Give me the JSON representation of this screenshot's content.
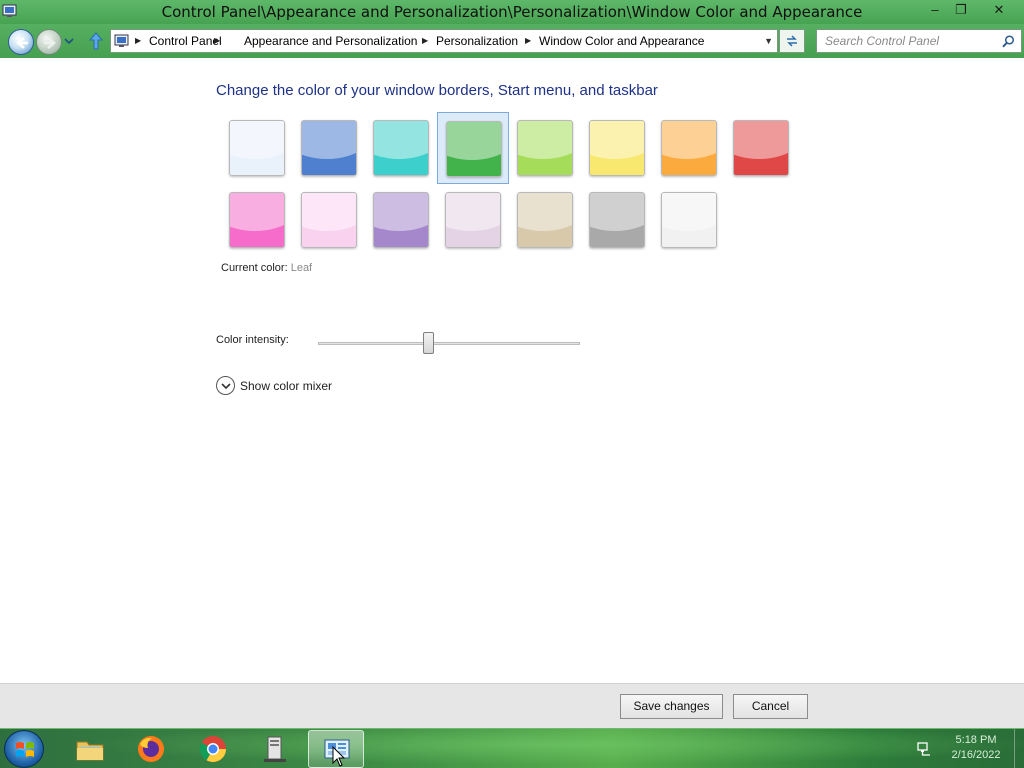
{
  "window": {
    "title": "Control Panel\\Appearance and Personalization\\Personalization\\Window Color and Appearance",
    "min_glyph": "–",
    "max_glyph": "❐",
    "close_glyph": "✕"
  },
  "address_bar": {
    "breadcrumbs": [
      "Control Panel",
      "Appearance and Personalization",
      "Personalization",
      "Window Color and Appearance"
    ],
    "separator": "▶",
    "dropdown_glyph": "▼"
  },
  "search": {
    "placeholder": "Search Control Panel"
  },
  "content": {
    "heading": "Change the color of your window borders, Start menu, and taskbar",
    "colors": [
      {
        "name": "Sky",
        "hex": "#e9f1fb"
      },
      {
        "name": "Twilight",
        "hex": "#4f7fcf"
      },
      {
        "name": "Sea",
        "hex": "#3ccfcb"
      },
      {
        "name": "Leaf",
        "hex": "#42b24a",
        "selected": true
      },
      {
        "name": "Lime",
        "hex": "#a5dd5a"
      },
      {
        "name": "Sun",
        "hex": "#f8e86f"
      },
      {
        "name": "Pumpkin",
        "hex": "#fbaa3e"
      },
      {
        "name": "Blush",
        "hex": "#e04848"
      },
      {
        "name": "Rose",
        "hex": "#f56ccb"
      },
      {
        "name": "Fuchsia",
        "hex": "#f9d2f0"
      },
      {
        "name": "Violet",
        "hex": "#a588cc"
      },
      {
        "name": "Lavender",
        "hex": "#e3d3e5"
      },
      {
        "name": "Taupe",
        "hex": "#d7c9a9"
      },
      {
        "name": "Chocolate",
        "hex": "#a9a9a9"
      },
      {
        "name": "Frost",
        "hex": "#f1f1f1"
      }
    ],
    "current_color_label": "Current color:",
    "current_color_value": "Leaf",
    "intensity_label": "Color intensity:",
    "intensity_value": 0.4,
    "show_mixer_label": "Show color mixer"
  },
  "footer": {
    "save_label": "Save changes",
    "cancel_label": "Cancel"
  },
  "taskbar": {
    "items": [
      {
        "name": "file-explorer",
        "active": false
      },
      {
        "name": "firefox",
        "active": false
      },
      {
        "name": "chrome",
        "active": false
      },
      {
        "name": "server-manager",
        "active": false
      },
      {
        "name": "control-panel",
        "active": true
      }
    ],
    "clock_time": "5:18 PM",
    "clock_date": "2/16/2022"
  },
  "accent_colors": {
    "window_chrome": "#4aa656",
    "heading_text": "#1e3287"
  }
}
